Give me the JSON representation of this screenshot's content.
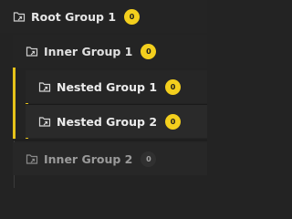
{
  "tree": {
    "root": {
      "label": "Root Group 1",
      "count": "0",
      "icon": "folder-link-icon",
      "active": true
    },
    "inner1": {
      "label": "Inner Group 1",
      "count": "0",
      "icon": "folder-link-icon",
      "active": true
    },
    "nested1": {
      "label": "Nested Group 1",
      "count": "0",
      "icon": "folder-link-icon",
      "active": true
    },
    "nested2": {
      "label": "Nested Group 2",
      "count": "0",
      "icon": "folder-link-icon",
      "active": true
    },
    "inner2": {
      "label": "Inner Group 2",
      "count": "0",
      "icon": "folder-link-icon",
      "active": false
    }
  },
  "colors": {
    "background": "#232323",
    "accent": "#f3cf1d",
    "rail": "#e6c21a",
    "inactive_text": "#9a9a9a"
  }
}
